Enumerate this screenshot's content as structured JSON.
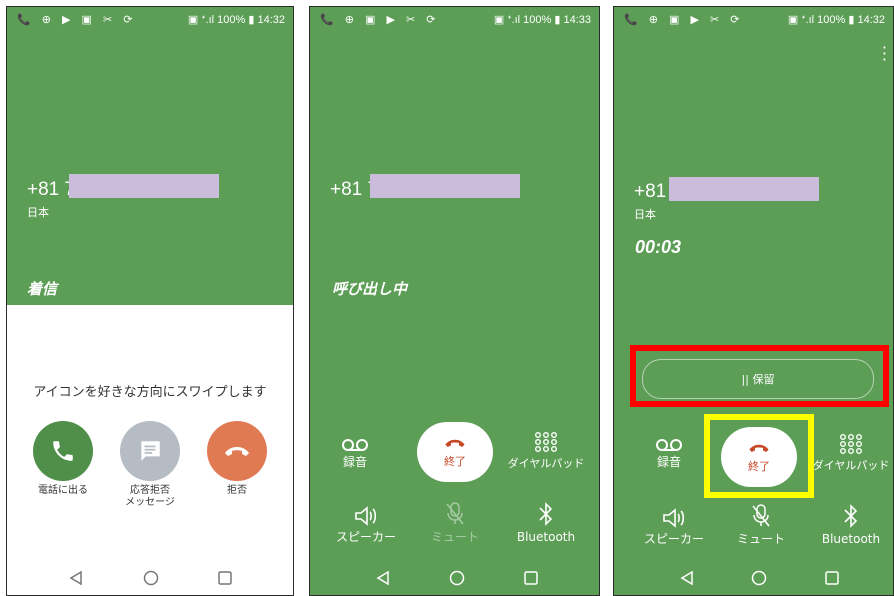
{
  "panels": [
    {
      "status": {
        "left_icons": "📞 ⊕ ▶ ▣ ✂ ⟳",
        "right": "▣ ᐩ.ıl 100% ▮ 14:32"
      },
      "number_prefix": "+81 7",
      "country": "日本",
      "state": "着信",
      "swipe_hint": "アイコンを好きな方向にスワイプします",
      "answer_label": "電話に出る",
      "message_label": "応答拒否\nメッセージ",
      "decline_label": "拒否"
    },
    {
      "status": {
        "left_icons": "📞 ⊕ ▣ ▶ ✂ ⟳",
        "right": "▣ ᐩ.ıl 100% ▮ 14:33"
      },
      "number_prefix": "+81 7",
      "state": "呼び出し中",
      "record_label": "録音",
      "end_label": "終了",
      "dialpad_label": "ダイヤルパッド",
      "speaker_label": "スピーカー",
      "mute_label": "ミュート",
      "bluetooth_label": "Bluetooth"
    },
    {
      "status": {
        "left_icons": "📞 ⊕ ▣ ▶ ✂ ⟳",
        "right": "▣ ᐩ.ıl 100% ▮ 14:32"
      },
      "number_prefix": "+81",
      "country": "日本",
      "timer": "00:03",
      "hold_label": "|| 保留",
      "record_label": "録音",
      "end_label": "終了",
      "dialpad_label": "ダイヤルパッド",
      "speaker_label": "スピーカー",
      "mute_label": "ミュート",
      "bluetooth_label": "Bluetooth"
    }
  ],
  "colors": {
    "call_green": "#5d9e57",
    "answer_green": "#4f8f4a",
    "decline_orange": "#e07a52",
    "message_gray": "#b5bcc4",
    "redaction": "#cbbcdc",
    "highlight_red": "#ff0000",
    "highlight_yellow": "#ffff00"
  }
}
